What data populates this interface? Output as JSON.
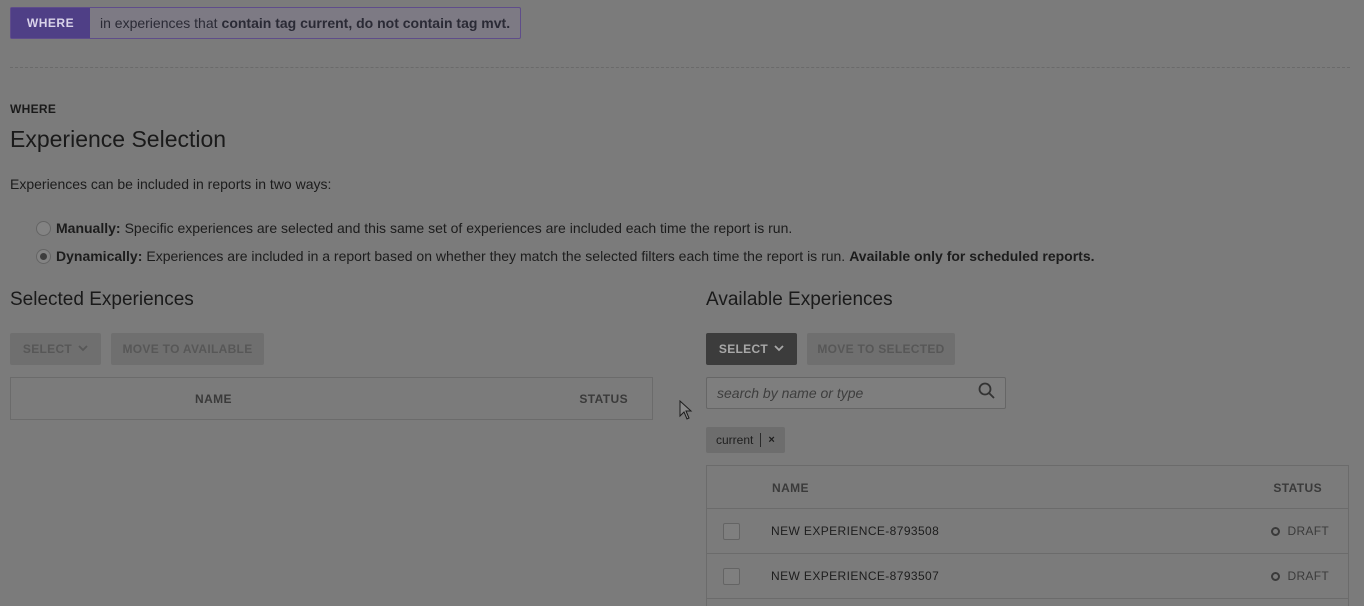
{
  "where_bar": {
    "tag": "WHERE",
    "text_prefix": "in experiences that",
    "text_bold": "contain tag current, do not contain tag mvt."
  },
  "section": {
    "label": "WHERE",
    "title": "Experience Selection",
    "intro": "Experiences can be included in reports in two ways:"
  },
  "options": {
    "manual": {
      "label": "Manually:",
      "text": "Specific experiences are selected and this same set of experiences are included each time the report is run.",
      "checked": false
    },
    "dynamic": {
      "label": "Dynamically:",
      "text": "Experiences are included in a report based on whether they match the selected filters each time the report is run.",
      "tail": "Available only for scheduled reports.",
      "checked": true
    }
  },
  "selected_panel": {
    "title": "Selected Experiences",
    "select_label": "SELECT",
    "move_label": "MOVE TO AVAILABLE",
    "col_name": "NAME",
    "col_status": "STATUS"
  },
  "available_panel": {
    "title": "Available Experiences",
    "select_label": "SELECT",
    "move_label": "MOVE TO SELECTED",
    "search_placeholder": "search by name or type",
    "chip_label": "current",
    "chip_remove": "×",
    "col_name": "NAME",
    "col_status": "STATUS",
    "rows": [
      {
        "name": "NEW EXPERIENCE-8793508",
        "status": "DRAFT"
      },
      {
        "name": "NEW EXPERIENCE-8793507",
        "status": "DRAFT"
      }
    ]
  },
  "icons": {
    "search": "search-icon",
    "chevron": "chevron-down-icon",
    "cursor": "pointer-cursor"
  },
  "colors": {
    "where_tag_bg": "#4f3f86",
    "overlay_bg": "#7b7b7b"
  }
}
